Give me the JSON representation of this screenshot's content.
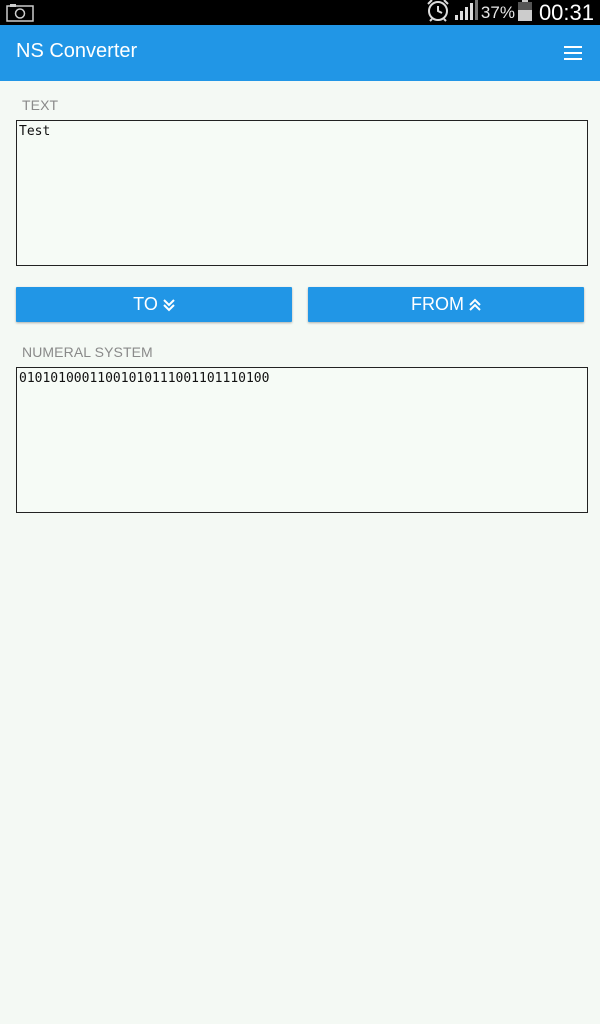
{
  "status_bar": {
    "battery_percent": "37%",
    "time": "00:31",
    "icons": [
      "screenshot-icon",
      "alarm-icon",
      "signal-icon",
      "battery-icon"
    ]
  },
  "app_bar": {
    "title": "NS Converter",
    "menu_icon": "menu-icon"
  },
  "text_section": {
    "label": "TEXT",
    "value": "Test"
  },
  "buttons": {
    "to_label": "TO",
    "to_icon": "double-chevron-down-icon",
    "from_label": "FROM",
    "from_icon": "double-chevron-up-icon"
  },
  "numeral_section": {
    "label": "NUMERAL SYSTEM",
    "value": "01010100011001010111001101110100"
  },
  "colors": {
    "primary": "#2196e6",
    "background": "#f4f9f4",
    "status_bar": "#000000",
    "label": "#8a8a8a"
  }
}
